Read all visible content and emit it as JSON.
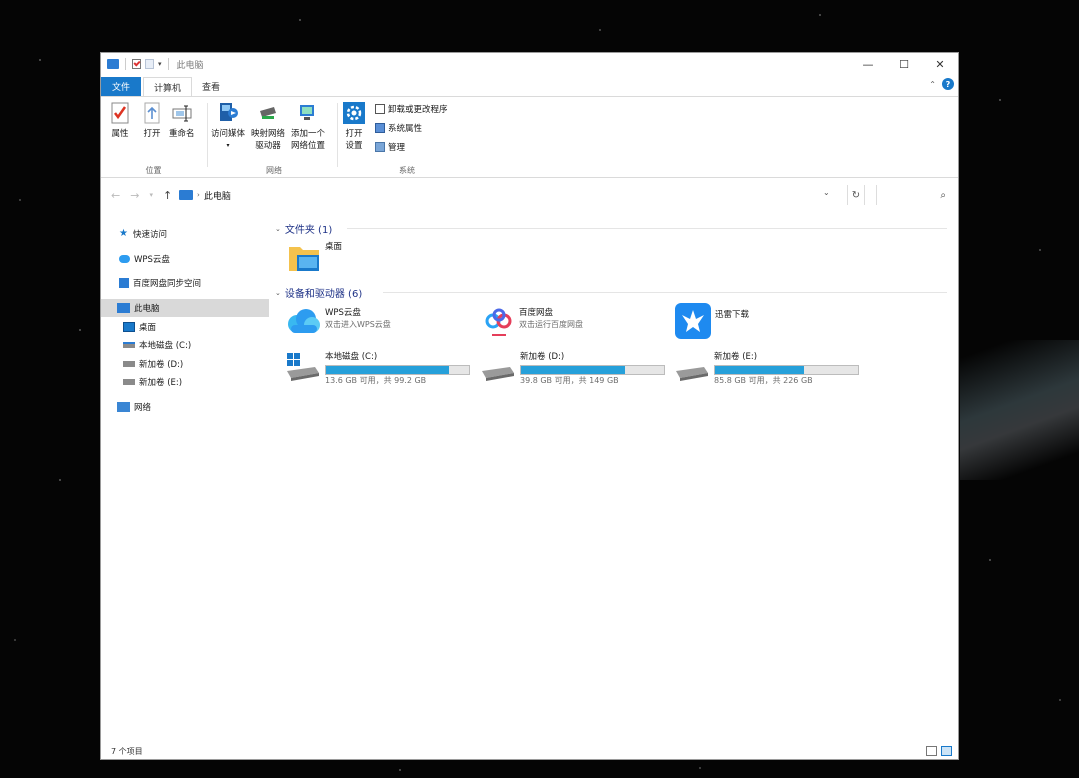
{
  "window": {
    "title": "此电脑"
  },
  "ribbon_tabs": [
    {
      "label": "文件"
    },
    {
      "label": "计算机"
    },
    {
      "label": "查看"
    }
  ],
  "ribbon": {
    "groups": {
      "location": {
        "label": "位置",
        "properties": "属性",
        "open": "打开",
        "rename": "重命名"
      },
      "network": {
        "label": "网络",
        "access_media": "访问媒体",
        "map_drive_1": "映射网络",
        "map_drive_2": "驱动器",
        "add_location_1": "添加一个",
        "add_location_2": "网络位置"
      },
      "system": {
        "label": "系统",
        "open_settings_1": "打开",
        "open_settings_2": "设置",
        "uninstall": "卸载或更改程序",
        "system_props": "系统属性",
        "manage": "管理"
      }
    }
  },
  "address": {
    "path": "此电脑"
  },
  "search": {
    "placeholder": ""
  },
  "navpane": {
    "items": [
      {
        "label": "快速访问"
      },
      {
        "label": "WPS云盘"
      },
      {
        "label": "百度网盘同步空间"
      },
      {
        "label": "此电脑"
      },
      {
        "label": "桌面"
      },
      {
        "label": "本地磁盘 (C:)"
      },
      {
        "label": "新加卷 (D:)"
      },
      {
        "label": "新加卷 (E:)"
      },
      {
        "label": "网络"
      }
    ]
  },
  "content": {
    "folders_header": "文件夹 (1)",
    "folders": [
      {
        "name": "桌面"
      }
    ],
    "devices_header": "设备和驱动器 (6)",
    "apps": [
      {
        "name": "WPS云盘",
        "sub": "双击进入WPS云盘"
      },
      {
        "name": "百度网盘",
        "sub": "双击运行百度网盘"
      },
      {
        "name": "迅雷下载",
        "sub": ""
      }
    ],
    "drives": [
      {
        "name": "本地磁盘 (C:)",
        "free": "13.6 GB 可用，共 99.2 GB",
        "used_fraction": 0.86
      },
      {
        "name": "新加卷 (D:)",
        "free": "39.8 GB 可用，共 149 GB",
        "used_fraction": 0.73
      },
      {
        "name": "新加卷 (E:)",
        "free": "85.8 GB 可用，共 226 GB",
        "used_fraction": 0.62
      }
    ]
  },
  "status": {
    "items": "7 个项目"
  },
  "colors": {
    "accent": "#1979ca",
    "drive_fill": "#26a0da",
    "section_header": "#1e3287"
  }
}
